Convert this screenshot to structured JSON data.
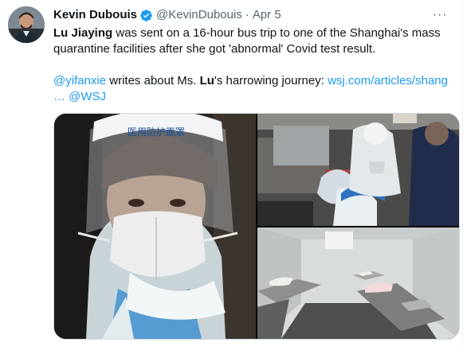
{
  "author": {
    "display_name": "Kevin Dubouis",
    "handle": "@KevinDubouis",
    "separator": "·",
    "date": "Apr 5",
    "verified": true,
    "avatar_icon": "profile-photo"
  },
  "menu": {
    "more_icon": "more-dots-icon",
    "more_glyph": "···"
  },
  "tweet": {
    "line1": {
      "name_bold": "Lu Jiaying",
      "rest": " was sent on a 16-hour bus trip to one of the Shanghai's mass quarantine facilities after she got 'abnormal' Covid test result."
    },
    "line2": {
      "mention": "@yifanxie",
      "text_a": " writes about Ms. ",
      "name_bold": "Lu",
      "text_b": "'s harrowing journey: ",
      "url": "wsj.com/articles/shang",
      "ellipsis": "…",
      "mention2": "@WSJ"
    }
  },
  "media": {
    "photos": [
      {
        "label": "woman-in-protective-suit-photo"
      },
      {
        "label": "bus-passengers-in-ppe-photo"
      },
      {
        "label": "quarantine-room-beds-photo"
      }
    ],
    "face_shield_text": "医用防护面罩"
  },
  "colors": {
    "link": "#1d9bf0",
    "verified": "#1d9bf0",
    "secondary_text": "#536471",
    "primary_text": "#0f1419"
  }
}
